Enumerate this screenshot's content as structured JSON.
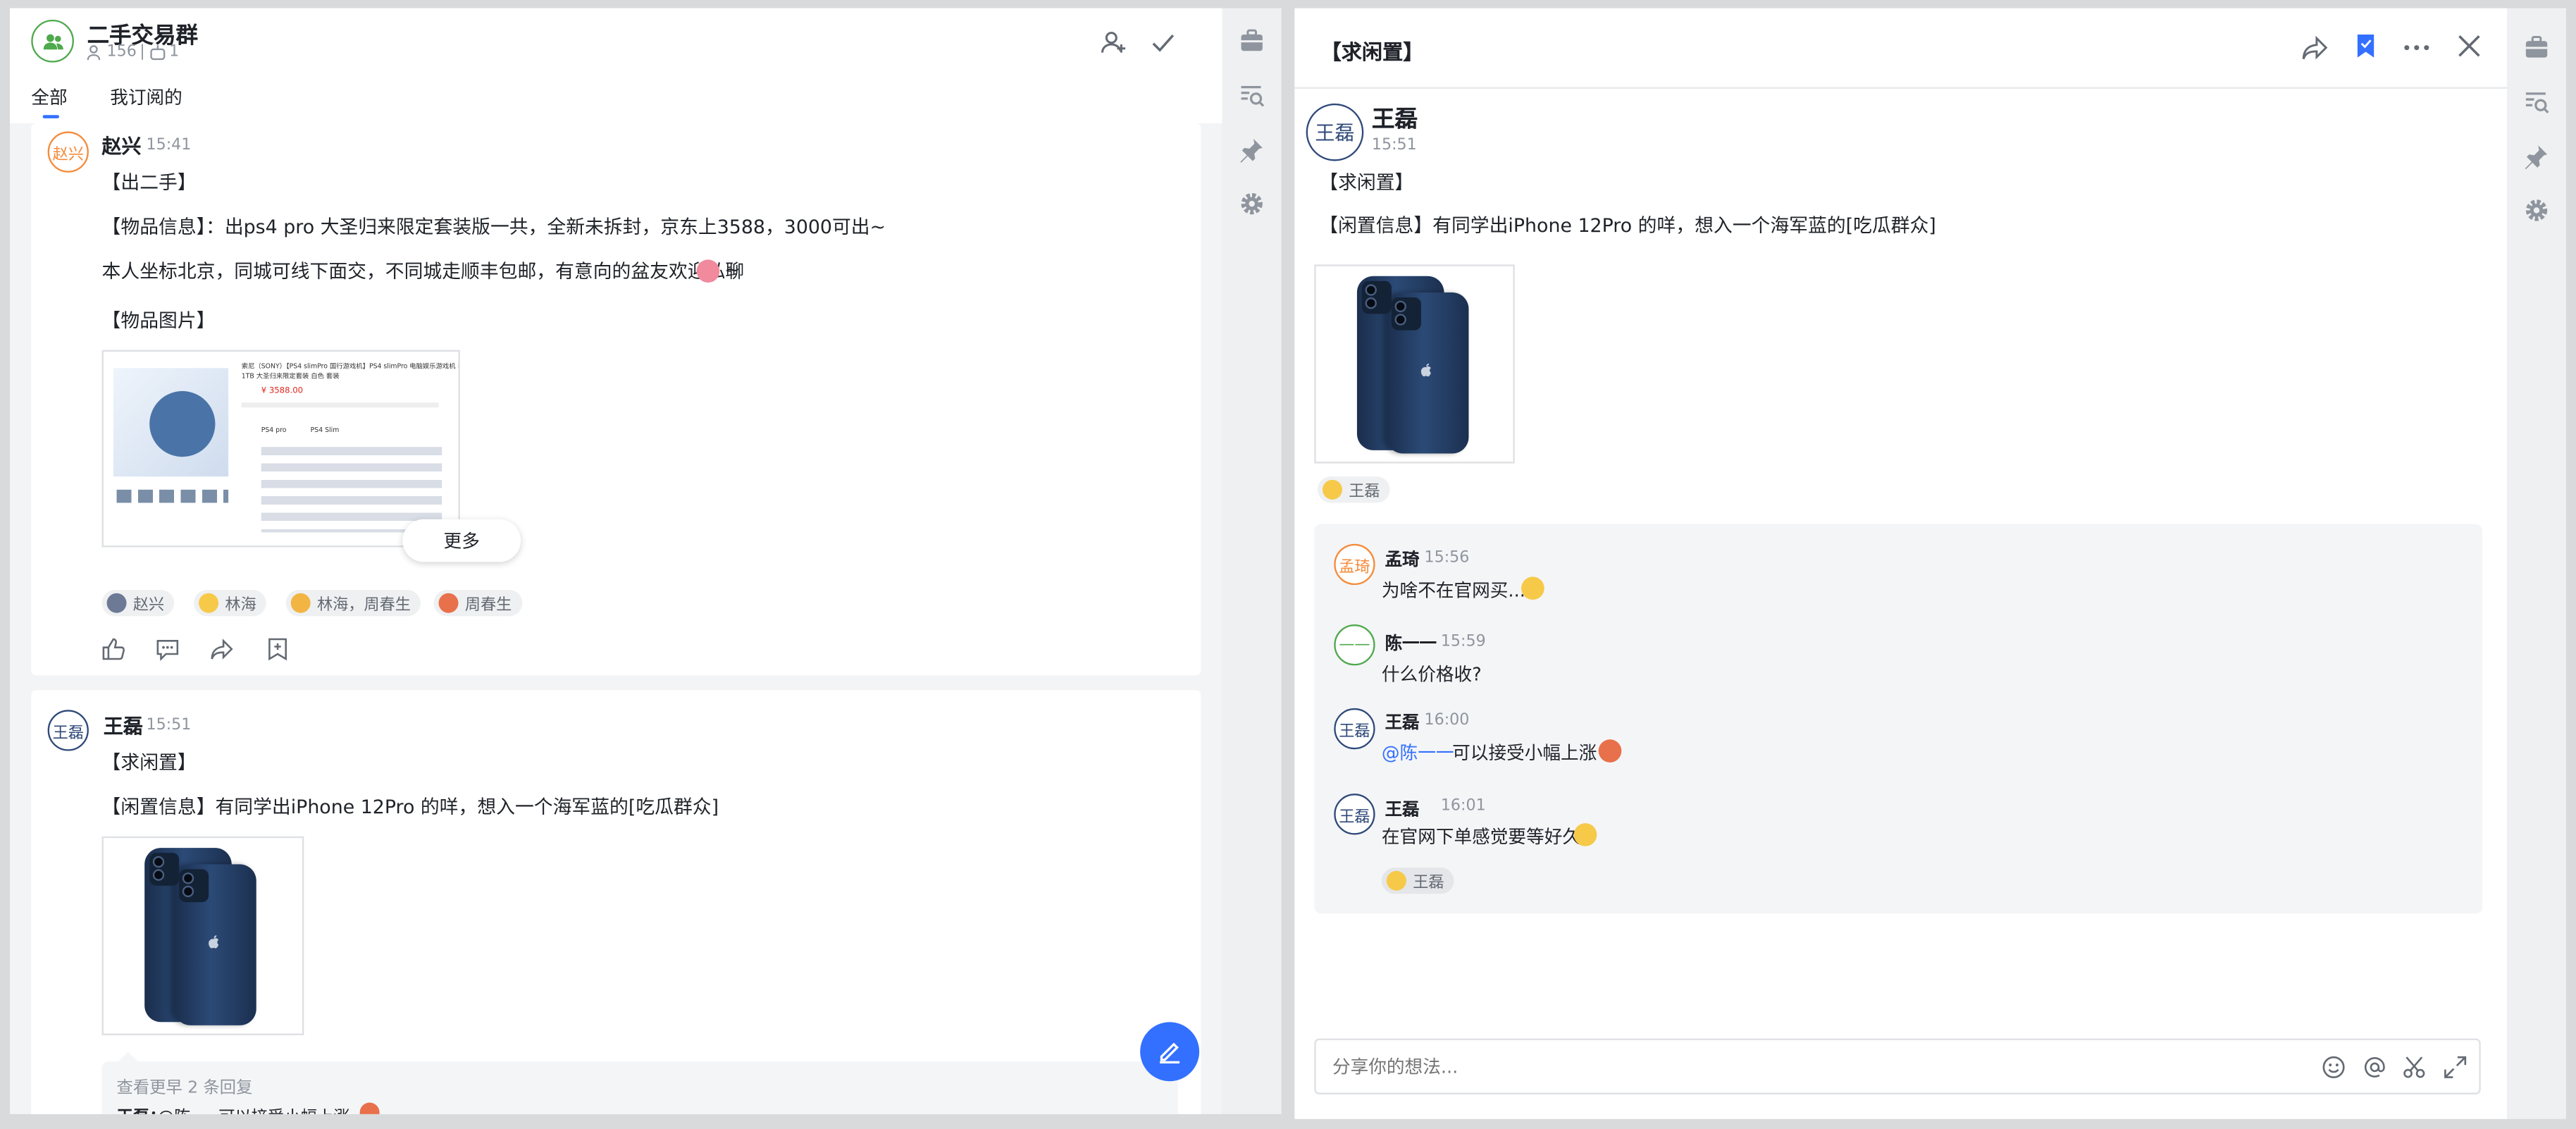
{
  "left": {
    "group_name": "二手交易群",
    "member_count": "156",
    "bot_count": "1",
    "tabs": [
      "全部",
      "我订阅的"
    ],
    "post1": {
      "avatar_text": "赵兴",
      "author": "赵兴",
      "time": "15:41",
      "line1": "【出二手】",
      "line2": "【物品信息】：出ps4 pro 大圣归来限定套装版一共，全新未拆封，京东上3588，3000可出~",
      "line3": "本人坐标北京，同城可线下面交，不同城走顺丰包邮，有意向的盆友欢迎私聊",
      "line3_tail": "~",
      "line4": "【物品图片】",
      "more_label": "更多",
      "screenshot_lines": [
        "索尼（SONY）【PS4 slimPro 国行游戏机】PS4 slimPro 电脑娱乐游戏机 Pro",
        "1TB 大圣归来限定套装 白色 套装",
        "¥ 3588.00",
        "PS4 pro",
        "PS4 Slim"
      ],
      "reactions": [
        "赵兴",
        "林海",
        "林海，周春生",
        "周春生"
      ]
    },
    "post2": {
      "avatar_text": "王磊",
      "author": "王磊",
      "time": "15:51",
      "line1": "【求闲置】",
      "line2": "【闲置信息】有同学出iPhone 12Pro 的咩，想入一个海军蓝的[吃瓜群众]",
      "view_more": "查看更早 2 条回复",
      "last_reply_author": "王磊：",
      "last_reply_mention": "@陈一一",
      "last_reply_text": " 可以接受小幅上涨"
    }
  },
  "right": {
    "title": "【求闲置】",
    "author": "王磊",
    "avatar_text": "王磊",
    "time": "15:51",
    "line1": "【求闲置】",
    "line2": "【闲置信息】有同学出iPhone 12Pro 的咩，想入一个海军蓝的[吃瓜群众]",
    "post_reaction": "王磊",
    "replies": [
      {
        "avatar": "孟琦",
        "name": "孟琦",
        "time": "15:56",
        "text": "为啥不在官网买..."
      },
      {
        "avatar": "——",
        "name": "陈一一",
        "time": "15:59",
        "text": "什么价格收?"
      },
      {
        "avatar": "王磊",
        "name": "王磊",
        "time": "16:00",
        "mention": "@陈一一",
        "text": " 可以接受小幅上涨"
      },
      {
        "avatar": "王磊",
        "name": "王磊",
        "time": "16:01",
        "text": "在官网下单感觉要等好久"
      }
    ],
    "reply_reaction": "王磊",
    "input_placeholder": "分享你的想法..."
  },
  "colors": {
    "accent": "#3370ff",
    "orange": "#f58b3b",
    "green": "#4fa94d",
    "navy": "#2f4a7a",
    "mention": "#3370ff"
  }
}
